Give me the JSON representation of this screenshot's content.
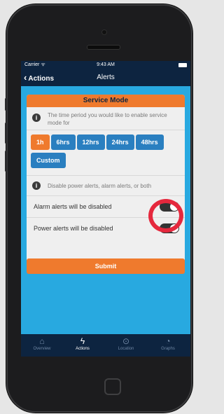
{
  "status_bar": {
    "carrier": "Carrier ᯤ",
    "time": "9:43 AM"
  },
  "nav": {
    "back_label": "Actions",
    "title": "Alerts"
  },
  "card": {
    "header": "Service Mode",
    "info1": "The time period you would like to enable service mode for",
    "time_options": [
      {
        "label": "1h",
        "active": true
      },
      {
        "label": "6hrs",
        "active": false
      },
      {
        "label": "12hrs",
        "active": false
      },
      {
        "label": "24hrs",
        "active": false
      },
      {
        "label": "48hrs",
        "active": false
      },
      {
        "label": "Custom",
        "active": false
      }
    ],
    "info2": "Disable power alerts, alarm alerts, or both",
    "alarm_label": "Alarm alerts will be disabled",
    "power_label": "Power alerts will be disabled",
    "alarm_toggle_on": true,
    "power_toggle_on": true
  },
  "submit_label": "Submit",
  "tabs": [
    {
      "label": "Overview",
      "icon": "home-icon"
    },
    {
      "label": "Actions",
      "icon": "lightning-icon"
    },
    {
      "label": "Location",
      "icon": "location-pin-icon"
    },
    {
      "label": "Graphs",
      "icon": "gauge-icon"
    }
  ],
  "colors": {
    "accent": "#ef7a2d",
    "primary": "#2a7fc0",
    "background": "#28a9e0",
    "navbar": "#0d2440",
    "highlight_ring": "#e5283d"
  }
}
